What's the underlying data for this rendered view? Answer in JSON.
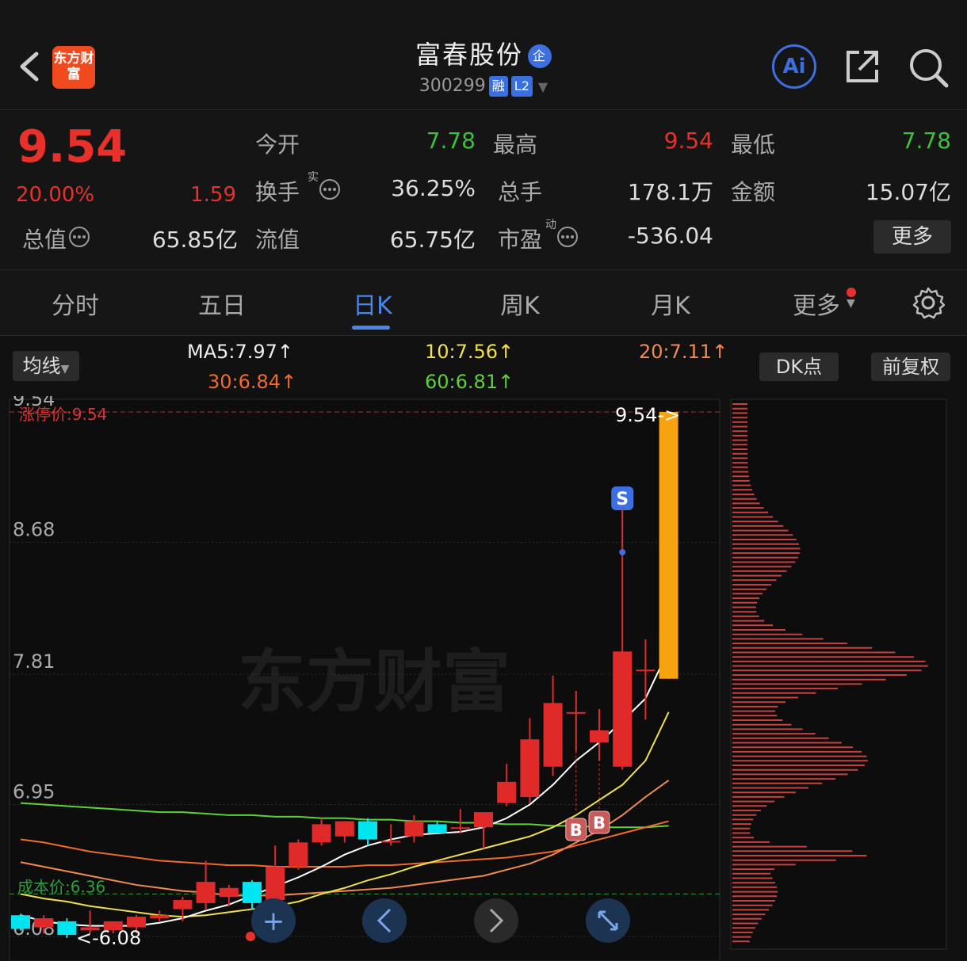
{
  "header": {
    "logo_text": "东方财富",
    "title": "富春股份",
    "title_badge": "企",
    "code": "300299",
    "tags": [
      "融",
      "L2"
    ],
    "ai_label": "Ai"
  },
  "quote": {
    "price": "9.54",
    "change_pct": "20.00%",
    "change": "1.59",
    "stats": [
      {
        "label": "今开",
        "value": "7.78",
        "color": "green"
      },
      {
        "label": "最高",
        "value": "9.54",
        "color": "red"
      },
      {
        "label": "最低",
        "value": "7.78",
        "color": "green"
      },
      {
        "label": "换手",
        "value": "36.25%",
        "color": "white",
        "sup": "实"
      },
      {
        "label": "总手",
        "value": "178.1万",
        "color": "white"
      },
      {
        "label": "金额",
        "value": "15.07亿",
        "color": "white"
      },
      {
        "label": "总值",
        "value": "65.85亿",
        "color": "white"
      },
      {
        "label": "流值",
        "value": "65.75亿",
        "color": "white"
      },
      {
        "label": "市盈",
        "value": "-536.04",
        "color": "white",
        "sup": "动"
      }
    ],
    "more_label": "更多"
  },
  "tabs": [
    "分时",
    "五日",
    "日K",
    "周K",
    "月K",
    "更多"
  ],
  "active_tab": "日K",
  "ma_bar": {
    "selector": "均线",
    "ma5": "MA5:7.97↑",
    "ma10": "10:7.56↑",
    "ma20": "20:7.11↑",
    "ma30": "30:6.84↑",
    "ma60": "60:6.81↑",
    "dk_label": "DK点",
    "adjust_label": "前复权"
  },
  "chart_data": {
    "type": "candlestick",
    "y_ticks": [
      "9.54",
      "8.68",
      "7.81",
      "6.95",
      "6.08"
    ],
    "limit_up_label": "涨停价:9.54",
    "last_price_label": "9.54->",
    "cost_label": "成本价:6.36",
    "low_label": "6.08",
    "ylim": [
      6.08,
      9.54
    ],
    "signals": [
      "S",
      "B",
      "B"
    ],
    "candles": [
      {
        "o": 6.22,
        "h": 6.23,
        "l": 6.12,
        "c": 6.13
      },
      {
        "o": 6.14,
        "h": 6.22,
        "l": 6.1,
        "c": 6.2
      },
      {
        "o": 6.18,
        "h": 6.2,
        "l": 6.07,
        "c": 6.09
      },
      {
        "o": 6.12,
        "h": 6.25,
        "l": 6.1,
        "c": 6.14
      },
      {
        "o": 6.12,
        "h": 6.18,
        "l": 6.1,
        "c": 6.18
      },
      {
        "o": 6.14,
        "h": 6.22,
        "l": 6.1,
        "c": 6.21
      },
      {
        "o": 6.2,
        "h": 6.25,
        "l": 6.18,
        "c": 6.22
      },
      {
        "o": 6.26,
        "h": 6.34,
        "l": 6.18,
        "c": 6.32
      },
      {
        "o": 6.3,
        "h": 6.58,
        "l": 6.26,
        "c": 6.44
      },
      {
        "o": 6.34,
        "h": 6.42,
        "l": 6.28,
        "c": 6.4
      },
      {
        "o": 6.44,
        "h": 6.45,
        "l": 6.26,
        "c": 6.3
      },
      {
        "o": 6.32,
        "h": 6.68,
        "l": 6.3,
        "c": 6.54
      },
      {
        "o": 6.54,
        "h": 6.72,
        "l": 6.52,
        "c": 6.7
      },
      {
        "o": 6.7,
        "h": 6.86,
        "l": 6.68,
        "c": 6.82
      },
      {
        "o": 6.74,
        "h": 6.84,
        "l": 6.7,
        "c": 6.84
      },
      {
        "o": 6.84,
        "h": 6.86,
        "l": 6.68,
        "c": 6.72
      },
      {
        "o": 6.71,
        "h": 6.82,
        "l": 6.68,
        "c": 6.71
      },
      {
        "o": 6.74,
        "h": 6.88,
        "l": 6.7,
        "c": 6.84
      },
      {
        "o": 6.82,
        "h": 6.84,
        "l": 6.76,
        "c": 6.76
      },
      {
        "o": 6.8,
        "h": 6.92,
        "l": 6.76,
        "c": 6.8
      },
      {
        "o": 6.8,
        "h": 6.9,
        "l": 6.66,
        "c": 6.9
      },
      {
        "o": 6.96,
        "h": 7.22,
        "l": 6.94,
        "c": 7.1
      },
      {
        "o": 7.0,
        "h": 7.52,
        "l": 6.96,
        "c": 7.38
      },
      {
        "o": 7.2,
        "h": 7.8,
        "l": 7.14,
        "c": 7.62
      },
      {
        "o": 7.56,
        "h": 7.7,
        "l": 7.3,
        "c": 7.56
      },
      {
        "o": 7.36,
        "h": 7.58,
        "l": 7.24,
        "c": 7.44
      },
      {
        "o": 7.2,
        "h": 8.92,
        "l": 7.18,
        "c": 7.96
      },
      {
        "o": 7.84,
        "h": 8.04,
        "l": 7.51,
        "c": 7.84
      },
      {
        "o": 7.78,
        "h": 9.54,
        "l": 7.78,
        "c": 9.54
      }
    ],
    "ma5": [
      6.22,
      6.18,
      6.16,
      6.15,
      6.15,
      6.15,
      6.17,
      6.2,
      6.25,
      6.29,
      6.35,
      6.41,
      6.47,
      6.54,
      6.62,
      6.68,
      6.72,
      6.75,
      6.76,
      6.77,
      6.8,
      6.86,
      6.95,
      7.08,
      7.24,
      7.36,
      7.5,
      7.65,
      7.97
    ],
    "ma10": [
      6.36,
      6.33,
      6.31,
      6.28,
      6.26,
      6.24,
      6.22,
      6.21,
      6.22,
      6.24,
      6.26,
      6.28,
      6.31,
      6.36,
      6.4,
      6.45,
      6.49,
      6.54,
      6.58,
      6.62,
      6.66,
      6.7,
      6.74,
      6.8,
      6.88,
      6.98,
      7.08,
      7.24,
      7.56
    ],
    "ma20": [
      6.57,
      6.54,
      6.51,
      6.48,
      6.45,
      6.42,
      6.4,
      6.38,
      6.37,
      6.35,
      6.35,
      6.35,
      6.36,
      6.37,
      6.38,
      6.39,
      6.4,
      6.42,
      6.44,
      6.46,
      6.48,
      6.52,
      6.56,
      6.62,
      6.7,
      6.78,
      6.88,
      7.0,
      7.11
    ],
    "ma30": [
      6.72,
      6.7,
      6.67,
      6.64,
      6.62,
      6.6,
      6.58,
      6.57,
      6.56,
      6.55,
      6.55,
      6.54,
      6.54,
      6.54,
      6.54,
      6.55,
      6.55,
      6.56,
      6.57,
      6.58,
      6.59,
      6.6,
      6.62,
      6.64,
      6.68,
      6.72,
      6.76,
      6.8,
      6.84
    ],
    "ma60": [
      6.96,
      6.95,
      6.94,
      6.93,
      6.92,
      6.91,
      6.9,
      6.9,
      6.89,
      6.88,
      6.88,
      6.87,
      6.87,
      6.86,
      6.86,
      6.85,
      6.85,
      6.84,
      6.84,
      6.83,
      6.83,
      6.82,
      6.82,
      6.81,
      6.81,
      6.8,
      6.8,
      6.8,
      6.81
    ]
  }
}
